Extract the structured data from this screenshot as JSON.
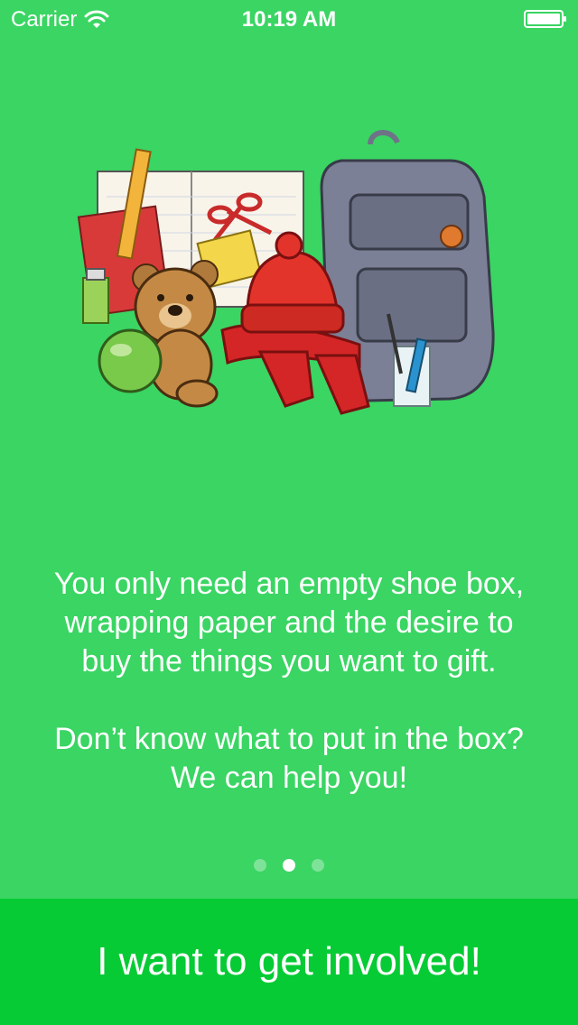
{
  "status_bar": {
    "carrier": "Carrier",
    "time": "10:19 AM",
    "wifi_icon": "wifi-icon",
    "battery_icon": "battery-icon"
  },
  "illustration": {
    "name": "gift-items-illustration",
    "items": [
      "notebook",
      "ruler",
      "scissors",
      "glue",
      "teddy-bear",
      "green-ball",
      "red-wool-hat",
      "red-scarf",
      "backpack",
      "toothbrush",
      "toothpaste",
      "glass-cup"
    ]
  },
  "onboarding": {
    "paragraph_1": "You only need an empty shoe box, wrapping paper and the desire to buy the things you want to gift.",
    "paragraph_2": "Don’t know what to put in the box? We can help you!"
  },
  "pagination": {
    "total": 3,
    "current": 2
  },
  "cta": {
    "label": "I want to get involved!"
  },
  "colors": {
    "background": "#3AD563",
    "button": "#06CB35",
    "text": "#FFFFFF"
  }
}
